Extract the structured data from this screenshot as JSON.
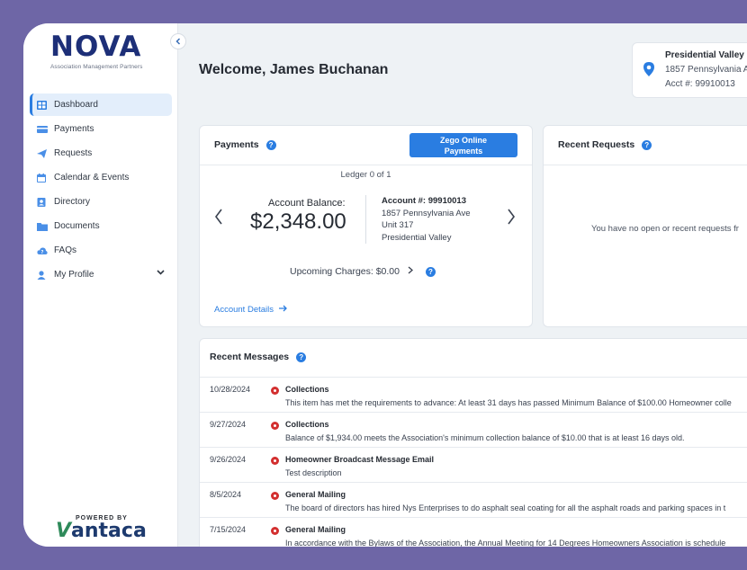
{
  "brand": {
    "logo_text": "NOVA",
    "logo_subtitle": "Association Management Partners",
    "powered_by": "POWERED BY",
    "vantaca_v": "V",
    "vantaca_rest": "antaca"
  },
  "sidebar": {
    "items": [
      {
        "label": "Dashboard",
        "icon": "dashboard-icon"
      },
      {
        "label": "Payments",
        "icon": "credit-card-icon"
      },
      {
        "label": "Requests",
        "icon": "paper-plane-icon"
      },
      {
        "label": "Calendar & Events",
        "icon": "calendar-icon"
      },
      {
        "label": "Directory",
        "icon": "address-book-icon"
      },
      {
        "label": "Documents",
        "icon": "folder-icon"
      },
      {
        "label": "FAQs",
        "icon": "cloud-question-icon"
      },
      {
        "label": "My Profile",
        "icon": "user-icon"
      }
    ]
  },
  "header": {
    "welcome": "Welcome, James Buchanan"
  },
  "property": {
    "name": "Presidential Valley",
    "address": "1857 Pennsylvania A",
    "account": "Acct #: 99910013"
  },
  "payments": {
    "title": "Payments",
    "zego_line1": "Zego Online",
    "zego_line2": "Payments",
    "ledger": "Ledger 0 of 1",
    "balance_label": "Account Balance:",
    "balance_value": "$2,348.00",
    "account_number": "Account #: 99910013",
    "address_line1": "1857 Pennsylvania Ave",
    "address_line2": "Unit 317",
    "address_line3": "Presidential Valley",
    "upcoming": "Upcoming Charges: $0.00",
    "account_details": "Account Details"
  },
  "requests": {
    "title": "Recent Requests",
    "empty": "You have no open or recent requests fr"
  },
  "messages": {
    "title": "Recent Messages",
    "rows": [
      {
        "date": "10/28/2024",
        "subject": "Collections",
        "body": "This item has met the requirements to advance: At least 31 days has passed Minimum Balance of $100.00 Homeowner colle"
      },
      {
        "date": "9/27/2024",
        "subject": "Collections",
        "body": "Balance of $1,934.00 meets the Association's minimum collection balance of $10.00 that is at least 16 days old."
      },
      {
        "date": "9/26/2024",
        "subject": "Homeowner Broadcast Message Email",
        "body": "Test description"
      },
      {
        "date": "8/5/2024",
        "subject": "General Mailing",
        "body": "The board of directors has hired Nys Enterprises to do asphalt seal coating for all the asphalt roads and parking spaces in t"
      },
      {
        "date": "7/15/2024",
        "subject": "General Mailing",
        "body": "In accordance with the Bylaws of the Association, the Annual Meeting for 14 Degrees Homeowners Association is schedule"
      }
    ]
  },
  "colors": {
    "accent": "#2a7de1",
    "brand_navy": "#1d2f78",
    "frame": "#6e66a6",
    "alert": "#d32f2f"
  }
}
